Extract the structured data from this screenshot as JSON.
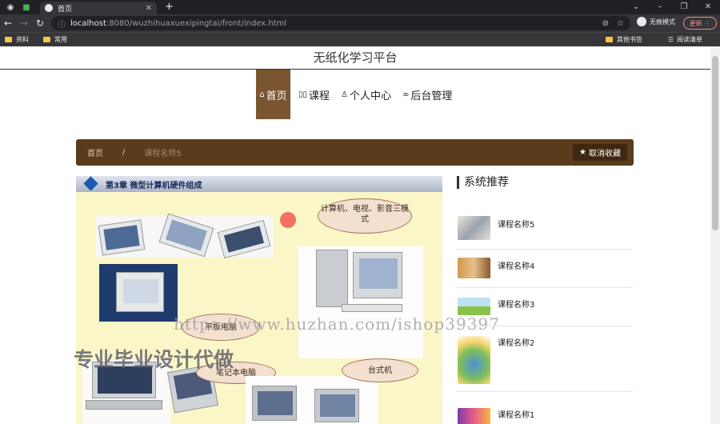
{
  "browser": {
    "tab_title": "首页",
    "url_host": "localhost",
    "url_rest": ":8080/wuzhihuaxuexipingtai/front/index.html",
    "incognito_label": "无痕模式",
    "update_label": "更新",
    "bookmarks": [
      "资料",
      "常用"
    ],
    "bookmarks_right": [
      "其他书签",
      "阅读清单"
    ]
  },
  "site": {
    "title": "无纸化学习平台",
    "nav": [
      {
        "label": "首页",
        "icon": "home-icon"
      },
      {
        "label": "课程",
        "icon": "book-icon"
      },
      {
        "label": "个人中心",
        "icon": "user-icon"
      },
      {
        "label": "后台管理",
        "icon": "link-icon"
      }
    ]
  },
  "breadcrumb": {
    "home": "首页",
    "separator": "/",
    "current": "课程名称5",
    "favorite_button": "取消收藏"
  },
  "slide": {
    "heading": "第3章 微型计算机硬件组成",
    "bubble_1": "计算机、电视、影音三模式",
    "bubble_2": "平板电脑",
    "bubble_3": "笔记本电脑",
    "bubble_4": "台式机",
    "watermark": "https://www.huzhan.com/ishop39397",
    "overlay_text": "专业毕业设计代做"
  },
  "recommend": {
    "title": "系统推荐",
    "items": [
      {
        "label": "课程名称5"
      },
      {
        "label": "课程名称4"
      },
      {
        "label": "课程名称3"
      },
      {
        "label": "课程名称2"
      },
      {
        "label": "课程名称1"
      }
    ]
  },
  "colors": {
    "accent": "#7a5530",
    "breadcrumb_bg": "#5a3b1b",
    "slide_bg": "#fbf6c7"
  }
}
